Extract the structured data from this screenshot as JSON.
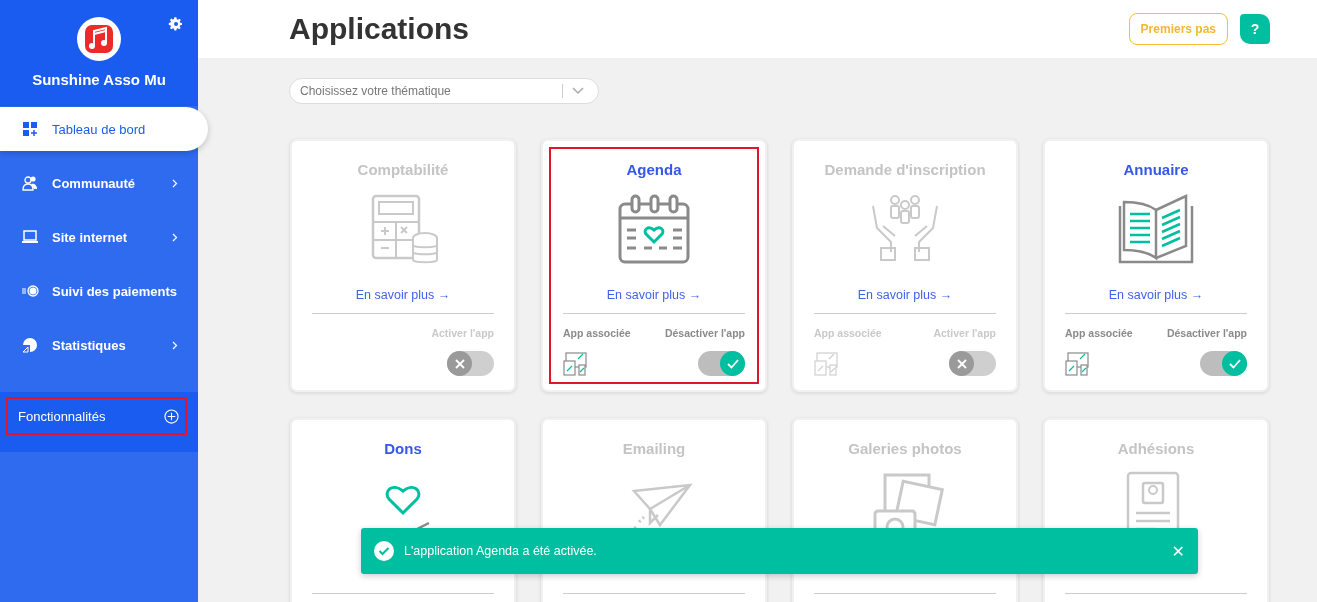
{
  "sidebar": {
    "org_name": "Sunshine Asso Mu",
    "items": [
      {
        "label": "Tableau de bord",
        "kind": "dashboard",
        "selected": true,
        "submenu": false
      },
      {
        "label": "Communauté",
        "kind": "people",
        "selected": false,
        "submenu": true
      },
      {
        "label": "Site internet",
        "kind": "laptop",
        "selected": false,
        "submenu": true
      },
      {
        "label": "Suivi des paiements",
        "kind": "payments",
        "selected": false,
        "submenu": false
      },
      {
        "label": "Statistiques",
        "kind": "pie",
        "selected": false,
        "submenu": true
      }
    ],
    "features": {
      "label": "Fonctionnalités",
      "highlighted": true
    }
  },
  "header": {
    "title": "Applications",
    "buttons": [
      {
        "kind": "outline",
        "label": "Premiers pas"
      },
      {
        "kind": "help",
        "label": "?"
      }
    ]
  },
  "filter": {
    "placeholder": "Choisissez votre thématique"
  },
  "cards": [
    {
      "title": "Comptabilité",
      "kind": "calculator",
      "enabled": false,
      "highlighted": false,
      "link": "En savoir plus →",
      "footer": {
        "toggle_label": "Activer l'app",
        "on": false
      }
    },
    {
      "title": "Agenda",
      "kind": "calendar",
      "enabled": true,
      "highlighted": true,
      "link": "En savoir plus →",
      "footer": {
        "associated": "App associée",
        "toggle_label": "Désactiver l'app",
        "on": true
      }
    },
    {
      "title": "Demande d'inscription",
      "kind": "hands",
      "enabled": false,
      "highlighted": false,
      "link": "En savoir plus →",
      "footer": {
        "associated": "App associée",
        "toggle_label": "Activer l'app",
        "on": false
      }
    },
    {
      "title": "Annuaire",
      "kind": "book",
      "enabled": true,
      "highlighted": false,
      "link": "En savoir plus →",
      "footer": {
        "associated": "App associée",
        "toggle_label": "Désactiver l'app",
        "on": true
      }
    },
    {
      "title": "Dons",
      "kind": "donation",
      "enabled": true,
      "highlighted": false
    },
    {
      "title": "Emailing",
      "kind": "plane",
      "enabled": false,
      "highlighted": false
    },
    {
      "title": "Galeries photos",
      "kind": "photos",
      "enabled": false,
      "highlighted": false
    },
    {
      "title": "Adhésions",
      "kind": "member",
      "enabled": false,
      "highlighted": false
    }
  ],
  "toast": {
    "message": "L'application Agenda a été activée.",
    "close": "✕"
  }
}
